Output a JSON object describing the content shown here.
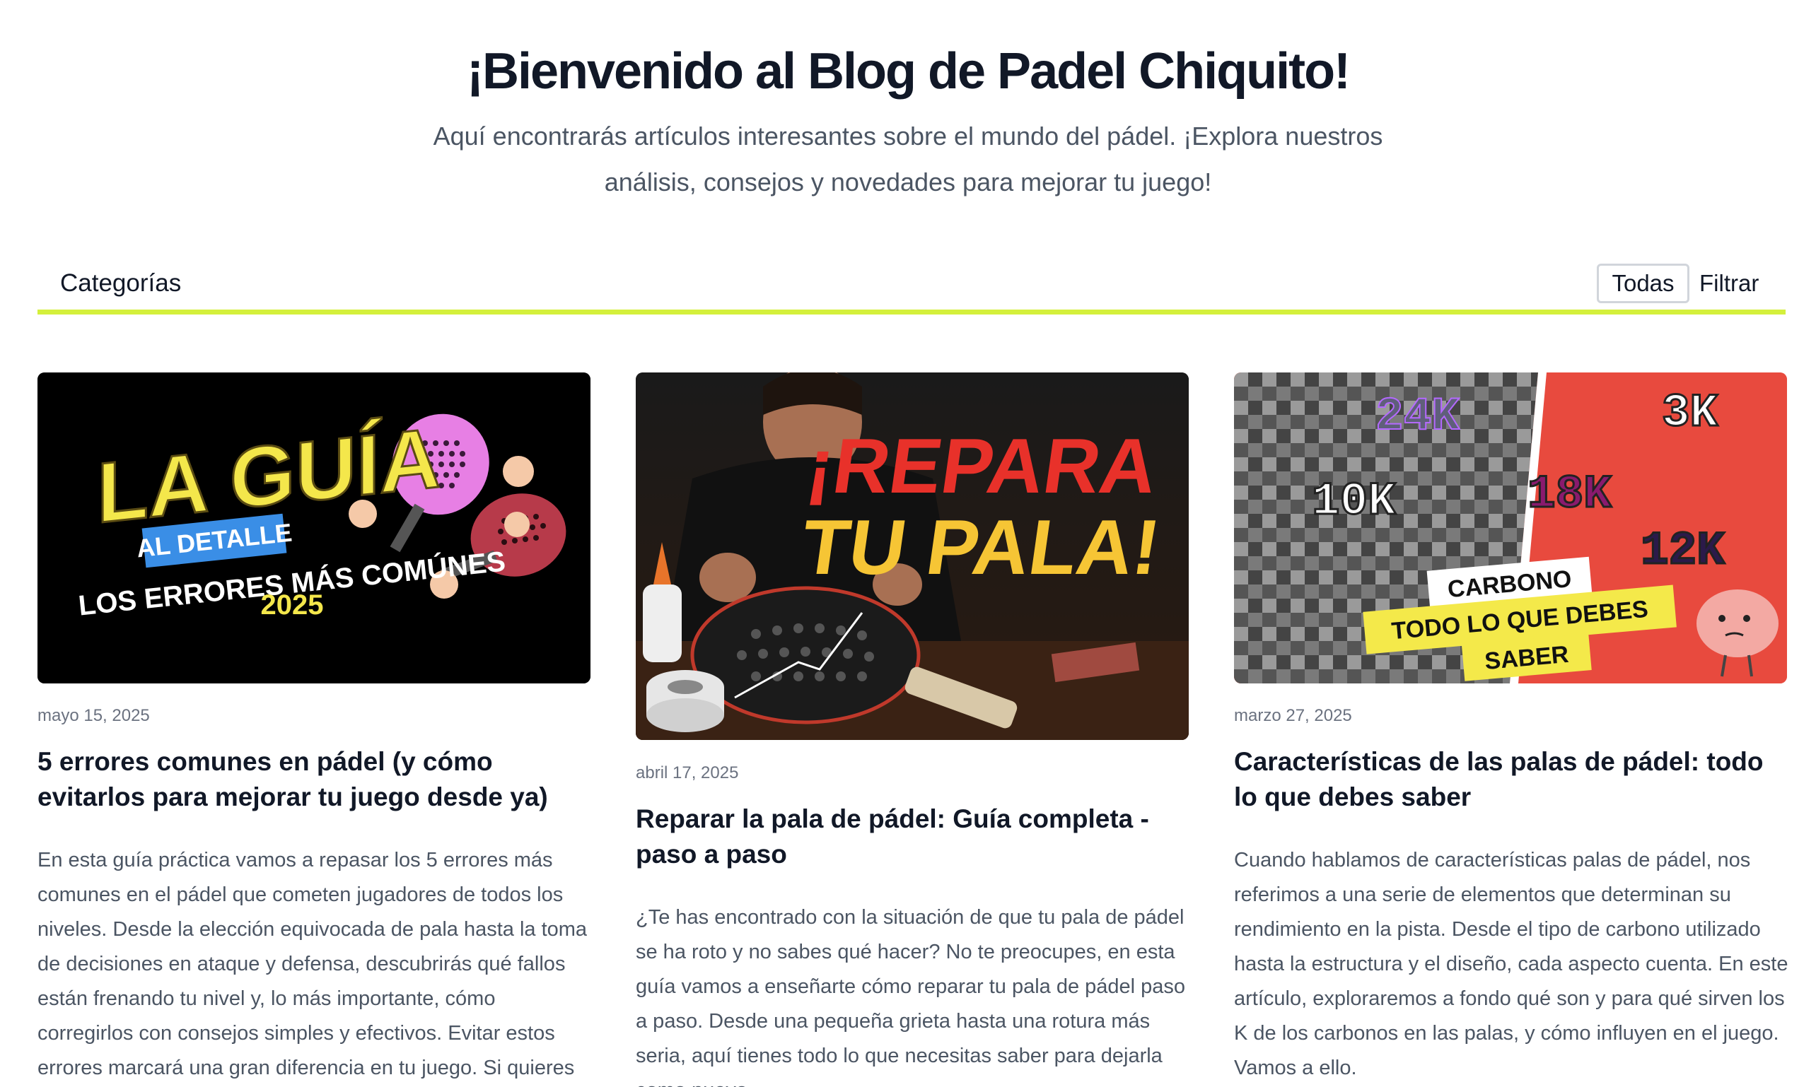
{
  "hero": {
    "title": "¡Bienvenido al Blog de Padel Chiquito!",
    "subtitle": "Aquí encontrarás artículos interesantes sobre el mundo del pádel. ¡Explora nuestros análisis, consejos y novedades para mejorar tu juego!"
  },
  "categories": {
    "title": "Categorías",
    "all_label": "Todas",
    "filter_label": "Filtrar",
    "accent_color": "#d4f03c"
  },
  "posts": [
    {
      "date": "mayo 15, 2025",
      "title": "5 errores comunes en pádel (y cómo evitarlos para mejorar tu juego desde ya)",
      "excerpt": "En esta guía práctica vamos a repasar los 5 errores más comunes en el pádel que cometen jugadores de todos los niveles. Desde la elección equivocada de pala hasta la toma de decisiones en ataque y defensa, descubrirás qué fallos están frenando tu nivel y, lo más importante, cómo corregirlos con consejos simples y efectivos. Evitar estos errores marcará una gran diferencia en tu juego. Si quieres mejorar tu técnica, ganar más puntos y sentirte más",
      "image": {
        "line1": "LA GUÍA",
        "badge": "AL DETALLE",
        "line2": "LOS ERRORES MÁS COMÚNES",
        "line3": "2025"
      }
    },
    {
      "date": "abril 17, 2025",
      "title": "Reparar la pala de pádel: Guía completa - paso a paso",
      "excerpt": "¿Te has encontrado con la situación de que tu pala de pádel se ha roto y no sabes qué hacer? No te preocupes, en esta guía vamos a enseñarte cómo reparar tu pala de pádel paso a paso. Desde una pequeña grieta hasta una rotura más seria, aquí tienes todo lo que necesitas saber para dejarla como nueva.",
      "image": {
        "line1": "¡REPARA",
        "line2": "TU PALA!"
      }
    },
    {
      "date": "marzo 27, 2025",
      "title": "Características de las palas de pádel: todo lo que debes saber",
      "excerpt": "Cuando hablamos de características palas de pádel, nos referimos a una serie de elementos que determinan su rendimiento en la pista. Desde el tipo de carbono utilizado hasta la estructura y el diseño, cada aspecto cuenta. En este artículo, exploraremos a fondo qué son y para qué sirven los K de los carbonos en las palas, y cómo influyen en el juego. Vamos a ello.",
      "image": {
        "k1": "24K",
        "k2": "3K",
        "k3": "10K",
        "k4": "18K",
        "k5": "12K",
        "tag1": "CARBONO",
        "tag2": "TODO LO QUE DEBES",
        "tag3": "SABER"
      }
    }
  ]
}
